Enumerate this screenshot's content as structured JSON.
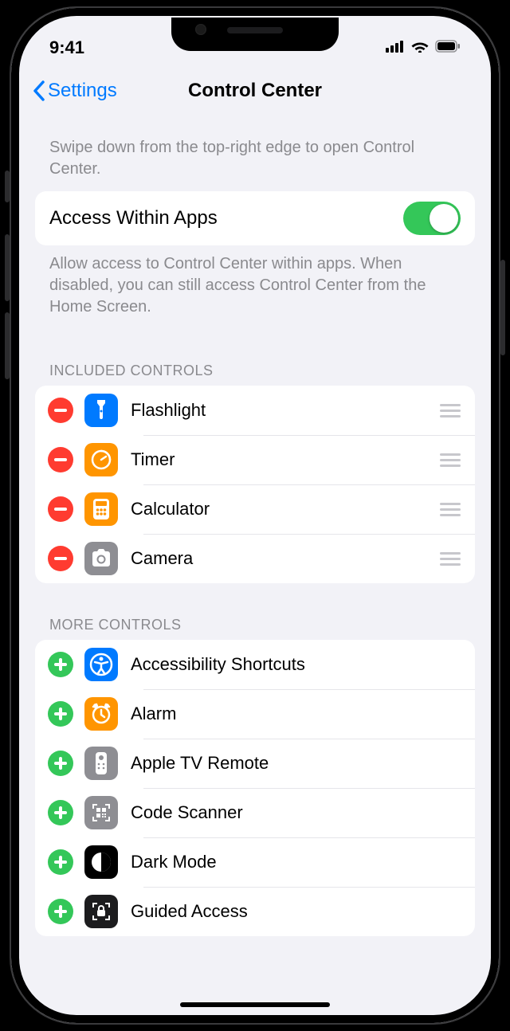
{
  "status": {
    "time": "9:41"
  },
  "nav": {
    "back": "Settings",
    "title": "Control Center"
  },
  "hint_top": "Swipe down from the top-right edge to open Control Center.",
  "access": {
    "label": "Access Within Apps",
    "enabled": true,
    "footer": "Allow access to Control Center within apps. When disabled, you can still access Control Center from the Home Screen."
  },
  "sections": {
    "included": {
      "header": "Included Controls",
      "items": [
        {
          "label": "Flashlight",
          "icon": "flashlight",
          "bg": "#007aff"
        },
        {
          "label": "Timer",
          "icon": "timer",
          "bg": "#ff9500"
        },
        {
          "label": "Calculator",
          "icon": "calculator",
          "bg": "#ff9500"
        },
        {
          "label": "Camera",
          "icon": "camera",
          "bg": "#8e8e93"
        }
      ]
    },
    "more": {
      "header": "More Controls",
      "items": [
        {
          "label": "Accessibility Shortcuts",
          "icon": "accessibility",
          "bg": "#007aff"
        },
        {
          "label": "Alarm",
          "icon": "alarm",
          "bg": "#ff9500"
        },
        {
          "label": "Apple TV Remote",
          "icon": "tvremote",
          "bg": "#8e8e93"
        },
        {
          "label": "Code Scanner",
          "icon": "qr",
          "bg": "#8e8e93"
        },
        {
          "label": "Dark Mode",
          "icon": "darkmode",
          "bg": "#000000"
        },
        {
          "label": "Guided Access",
          "icon": "guided",
          "bg": "#1c1c1e"
        }
      ]
    }
  }
}
